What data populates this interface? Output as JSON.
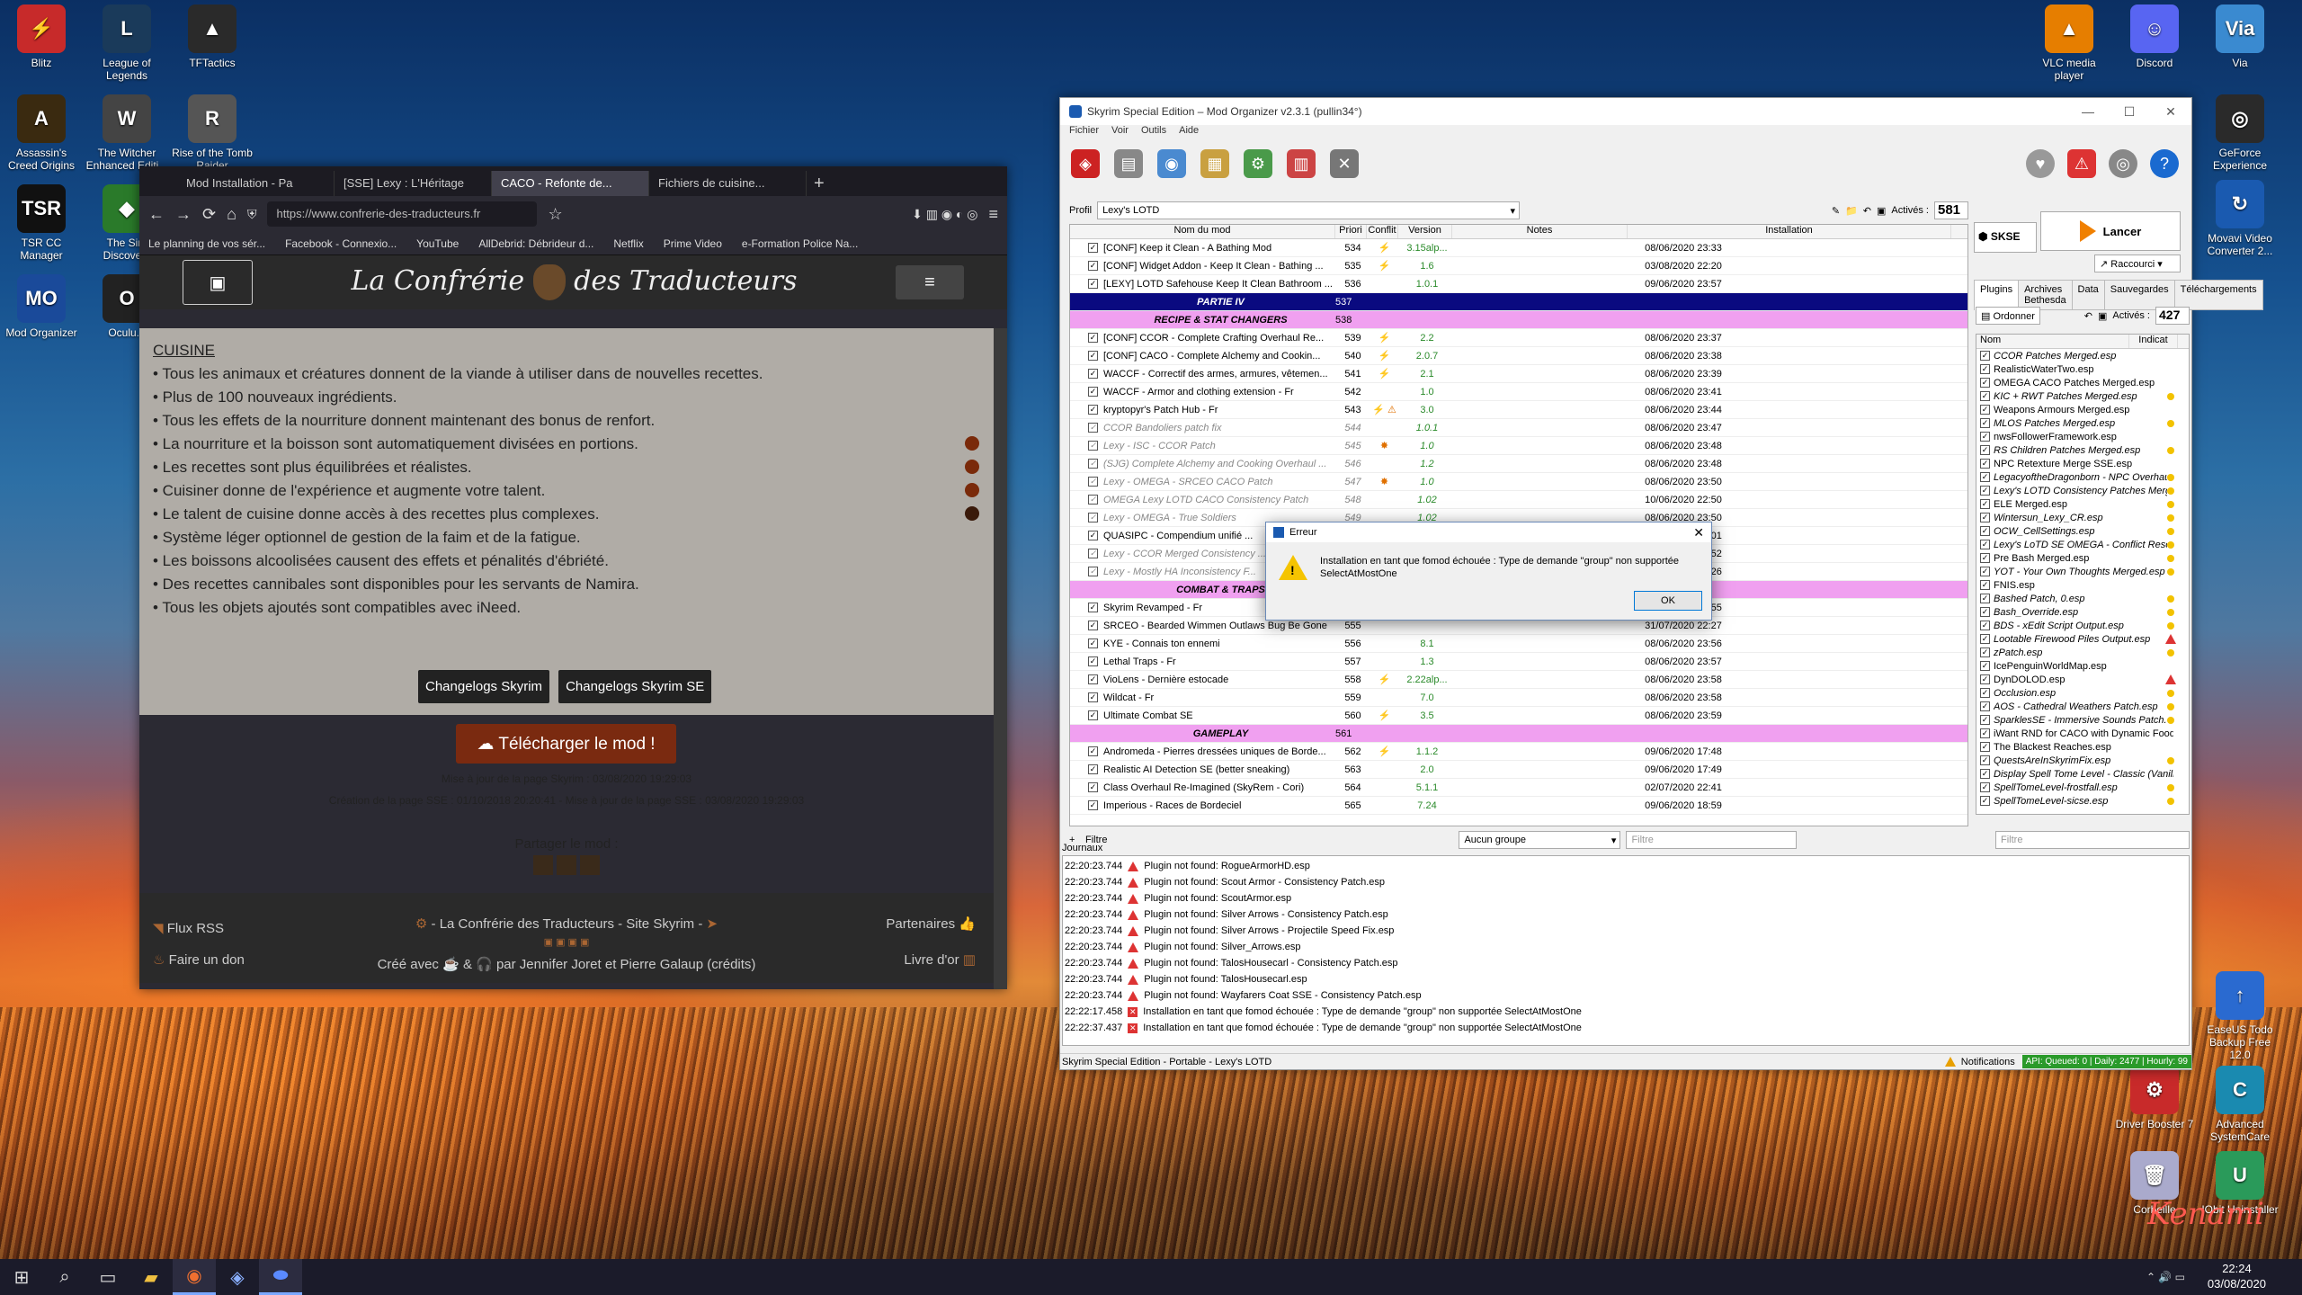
{
  "desktop": {
    "left_icons": [
      {
        "label": "Blitz",
        "color": "#c72a2a",
        "glyph": "⚡"
      },
      {
        "label": "League of Legends",
        "color": "#1a3a5a",
        "glyph": "L"
      },
      {
        "label": "TFTactics",
        "color": "#2a2a2a",
        "glyph": "▲"
      },
      {
        "label": "Assassin's Creed Origins",
        "color": "#3a2a10",
        "glyph": "A"
      },
      {
        "label": "The Witcher Enhanced Editi...",
        "color": "#444",
        "glyph": "W"
      },
      {
        "label": "Rise of the Tomb Raider",
        "color": "#555",
        "glyph": "R"
      },
      {
        "label": "TSR CC Manager",
        "color": "#111",
        "glyph": "TSR"
      },
      {
        "label": "The Sim Discove...",
        "color": "#2a7a2a",
        "glyph": "◆"
      },
      {
        "label": "Mod Organizer",
        "color": "#1a4a9a",
        "glyph": "MO"
      },
      {
        "label": "Oculu...",
        "color": "#222",
        "glyph": "O"
      }
    ],
    "right_icons": [
      {
        "label": "VLC media player",
        "color": "#e67e00",
        "glyph": "▲"
      },
      {
        "label": "Discord",
        "color": "#5865f2",
        "glyph": "☺"
      },
      {
        "label": "Via",
        "color": "#3a8ad0",
        "glyph": "Via"
      },
      {
        "label": "GeForce Experience",
        "color": "#2a2a2a",
        "glyph": "◎"
      },
      {
        "label": "Movavi Video Converter 2...",
        "color": "#1a5ab0",
        "glyph": "↻"
      },
      {
        "label": "EaseUS Todo Backup Free 12.0",
        "color": "#2a6ad0",
        "glyph": "↑"
      },
      {
        "label": "Driver Booster 7",
        "color": "#c82a2a",
        "glyph": "⚙"
      },
      {
        "label": "Advanced SystemCare",
        "color": "#1a8ab0",
        "glyph": "C"
      },
      {
        "label": "Corbeille",
        "color": "#aac",
        "glyph": "🗑"
      },
      {
        "label": "IObit Uninstaller",
        "color": "#2a9a5a",
        "glyph": "U"
      }
    ],
    "watermark": "Kenami"
  },
  "browser": {
    "tabs": [
      "Mod Installation - Pa",
      "[SSE] Lexy : L'Héritage",
      "CACO - Refonte de...",
      "Fichiers de cuisine..."
    ],
    "url": "https://www.confrerie-des-traducteurs.fr",
    "bookmarks": [
      "Le planning de vos sér...",
      "Facebook - Connexio...",
      "YouTube",
      "AllDebrid: Débrideur d...",
      "Netflix",
      "Prime Video",
      "e-Formation Police Na..."
    ],
    "site_title_left": "La Confrérie",
    "site_title_right": "des Traducteurs",
    "section": "CUISINE",
    "bullets": [
      "• Tous les animaux et créatures donnent de la viande à utiliser dans de nouvelles recettes.",
      "• Plus de 100 nouveaux ingrédients.",
      "• Tous les effets de la nourriture donnent maintenant des bonus de renfort.",
      "• La nourriture et la boisson sont automatiquement divisées en portions.",
      "• Les recettes sont plus équilibrées et réalistes.",
      "• Cuisiner donne de l'expérience et augmente votre talent.",
      "• Le talent de cuisine donne accès à des recettes plus complexes.",
      "• Système léger optionnel de gestion de la faim et de la fatigue.",
      "• Les boissons alcoolisées causent des effets et pénalités d'ébriété.",
      "• Des recettes cannibales sont disponibles pour les servants de Namira.",
      "• Tous les objets ajoutés sont compatibles avec iNeed."
    ],
    "btn_changelog_skyrim": "Changelogs Skyrim",
    "btn_changelog_se": "Changelogs Skyrim SE",
    "btn_download": "☁ Télécharger le mod !",
    "update_line": "Mise à jour de la page Skyrim : 03/08/2020 19:29:03",
    "creation_line": "Création de la page SSE : 01/10/2018 20:20:41 - Mise à jour de la page SSE : 03/08/2020 19:29:03",
    "share_label": "Partager le mod :",
    "footer": {
      "rss": "Flux RSS",
      "don": "Faire un don",
      "center": "- La Confrérie des Traducteurs - Site Skyrim -",
      "partners": "Partenaires",
      "guestbook": "Livre d'or",
      "credits": "Créé avec ☕ & 🎧 par Jennifer Joret et Pierre Galaup (crédits)"
    }
  },
  "mo": {
    "title": "Skyrim Special Edition – Mod Organizer v2.3.1 (pullin34°)",
    "menu": [
      "Fichier",
      "Voir",
      "Outils",
      "Aide"
    ],
    "profile_label": "Profil",
    "profile": "Lexy's LOTD",
    "active_label": "Activés :",
    "active_count": "581",
    "headers": [
      "Nom du mod",
      "Priori",
      "Conflit",
      "Version",
      "Notes",
      "Installation"
    ],
    "rows": [
      {
        "t": "m",
        "name": "[CONF] Keep it Clean - A Bathing Mod",
        "prio": "534",
        "conf": "⚡",
        "ver": "3.15alp...",
        "inst": "08/06/2020 23:33",
        "on": true
      },
      {
        "t": "m",
        "name": "[CONF] Widget Addon - Keep It Clean - Bathing ...",
        "prio": "535",
        "conf": "⚡",
        "ver": "1.6",
        "inst": "03/08/2020 22:20",
        "on": true
      },
      {
        "t": "m",
        "name": "[LEXY] LOTD Safehouse Keep It Clean Bathroom ...",
        "prio": "536",
        "conf": "",
        "ver": "1.0.1",
        "inst": "09/06/2020 23:57",
        "on": true
      },
      {
        "t": "s",
        "name": "PARTIE IV",
        "prio": "537",
        "bg": "#0a0a80",
        "fg": "#fff"
      },
      {
        "t": "s",
        "name": "RECIPE & STAT CHANGERS",
        "prio": "538",
        "bg": "#f0a0f0",
        "fg": "#000"
      },
      {
        "t": "m",
        "name": "[CONF] CCOR - Complete Crafting Overhaul Re...",
        "prio": "539",
        "conf": "⚡",
        "ver": "2.2",
        "inst": "08/06/2020 23:37",
        "on": true
      },
      {
        "t": "m",
        "name": "[CONF] CACO - Complete Alchemy and Cookin...",
        "prio": "540",
        "conf": "⚡",
        "ver": "2.0.7",
        "inst": "08/06/2020 23:38",
        "on": true
      },
      {
        "t": "m",
        "name": "WACCF - Correctif des armes, armures, vêtemen...",
        "prio": "541",
        "conf": "⚡",
        "ver": "2.1",
        "inst": "08/06/2020 23:39",
        "on": true
      },
      {
        "t": "m",
        "name": "WACCF - Armor and clothing extension - Fr",
        "prio": "542",
        "conf": "",
        "ver": "1.0",
        "inst": "08/06/2020 23:41",
        "on": true
      },
      {
        "t": "m",
        "name": "kryptopyr's Patch Hub - Fr",
        "prio": "543",
        "conf": "⚡ ⚠",
        "ver": "3.0",
        "inst": "08/06/2020 23:44",
        "on": true
      },
      {
        "t": "m",
        "name": "CCOR Bandoliers patch fix",
        "prio": "544",
        "conf": "",
        "ver": "1.0.1",
        "inst": "08/06/2020 23:47",
        "on": true,
        "it": true
      },
      {
        "t": "m",
        "name": "Lexy - ISC - CCOR Patch",
        "prio": "545",
        "conf": "✸",
        "ver": "1.0",
        "inst": "08/06/2020 23:48",
        "on": true,
        "it": true
      },
      {
        "t": "m",
        "name": "(SJG) Complete Alchemy and Cooking Overhaul ...",
        "prio": "546",
        "conf": "",
        "ver": "1.2",
        "inst": "08/06/2020 23:48",
        "on": true,
        "it": true
      },
      {
        "t": "m",
        "name": "Lexy - OMEGA - SRCEO CACO Patch",
        "prio": "547",
        "conf": "✸",
        "ver": "1.0",
        "inst": "08/06/2020 23:50",
        "on": true,
        "it": true
      },
      {
        "t": "m",
        "name": "OMEGA Lexy LOTD CACO Consistency Patch",
        "prio": "548",
        "conf": "",
        "ver": "1.02",
        "inst": "10/06/2020 22:50",
        "on": true,
        "it": true
      },
      {
        "t": "m",
        "name": "Lexy - OMEGA - True Soldiers",
        "prio": "549",
        "conf": "",
        "ver": "1.02",
        "inst": "08/06/2020 23:50",
        "on": true,
        "it": true
      },
      {
        "t": "m",
        "name": "QUASIPC - Compendium unifié ...",
        "prio": "550",
        "conf": "",
        "ver": "",
        "inst": "03/08/2020 09:01",
        "on": true
      },
      {
        "t": "m",
        "name": "Lexy - CCOR Merged Consistency ...",
        "prio": "551",
        "conf": "",
        "ver": "",
        "inst": "08/06/2020 23:52",
        "on": true,
        "it": true
      },
      {
        "t": "m",
        "name": "Lexy - Mostly HA Inconsistency F...",
        "prio": "552",
        "conf": "",
        "ver": "",
        "inst": "07/07/2020 22:26",
        "on": true,
        "it": true
      },
      {
        "t": "s",
        "name": "COMBAT & TRAPS",
        "prio": "553",
        "bg": "#f0a0f0",
        "fg": "#000"
      },
      {
        "t": "m",
        "name": "Skyrim Revamped - Fr",
        "prio": "554",
        "conf": "",
        "ver": "",
        "inst": "08/06/2020 23:55",
        "on": true
      },
      {
        "t": "m",
        "name": "SRCEO - Bearded Wimmen Outlaws Bug Be Gone",
        "prio": "555",
        "conf": "",
        "ver": "",
        "inst": "31/07/2020 22:27",
        "on": true
      },
      {
        "t": "m",
        "name": "KYE - Connais ton ennemi",
        "prio": "556",
        "conf": "",
        "ver": "8.1",
        "inst": "08/06/2020 23:56",
        "on": true
      },
      {
        "t": "m",
        "name": "Lethal Traps - Fr",
        "prio": "557",
        "conf": "",
        "ver": "1.3",
        "inst": "08/06/2020 23:57",
        "on": true
      },
      {
        "t": "m",
        "name": "VioLens - Dernière estocade",
        "prio": "558",
        "conf": "⚡",
        "ver": "2.22alp...",
        "inst": "08/06/2020 23:58",
        "on": true
      },
      {
        "t": "m",
        "name": "Wildcat - Fr",
        "prio": "559",
        "conf": "",
        "ver": "7.0",
        "inst": "08/06/2020 23:58",
        "on": true
      },
      {
        "t": "m",
        "name": "Ultimate Combat SE",
        "prio": "560",
        "conf": "⚡",
        "ver": "3.5",
        "inst": "08/06/2020 23:59",
        "on": true
      },
      {
        "t": "s",
        "name": "GAMEPLAY",
        "prio": "561",
        "bg": "#f0a0f0",
        "fg": "#000"
      },
      {
        "t": "m",
        "name": "Andromeda - Pierres dressées uniques de Borde...",
        "prio": "562",
        "conf": "⚡",
        "ver": "1.1.2",
        "inst": "09/06/2020 17:48",
        "on": true
      },
      {
        "t": "m",
        "name": "Realistic AI Detection SE (better sneaking)",
        "prio": "563",
        "conf": "",
        "ver": "2.0",
        "inst": "09/06/2020 17:49",
        "on": true
      },
      {
        "t": "m",
        "name": "Class Overhaul Re-Imagined (SkyRem - Cori)",
        "prio": "564",
        "conf": "",
        "ver": "5.1.1",
        "inst": "02/07/2020 22:41",
        "on": true
      },
      {
        "t": "m",
        "name": "Imperious - Races de Bordeciel",
        "prio": "565",
        "conf": "",
        "ver": "7.24",
        "inst": "09/06/2020 18:59",
        "on": true
      }
    ],
    "filter_label": "Filtre",
    "group_combo": "Aucun groupe",
    "filter_placeholder": "Filtre",
    "launcher": "SKSE",
    "launch_btn": "Lancer",
    "shortcut": "Raccourci",
    "right_tabs": [
      "Plugins",
      "Archives Bethesda",
      "Data",
      "Sauvegardes",
      "Téléchargements"
    ],
    "sort_btn": "Ordonner",
    "plugins_active_label": "Activés :",
    "plugins_active": "427",
    "plugin_headers": [
      "Nom",
      "Indicat"
    ],
    "plugins": [
      {
        "n": "CCOR Patches Merged.esp",
        "it": true,
        "ind": ""
      },
      {
        "n": "RealisticWaterTwo.esp",
        "it": false,
        "ind": ""
      },
      {
        "n": "OMEGA CACO Patches Merged.esp",
        "it": false,
        "ind": ""
      },
      {
        "n": "KIC + RWT Patches Merged.esp",
        "it": true,
        "ind": "y"
      },
      {
        "n": "Weapons Armours Merged.esp",
        "it": false,
        "ind": ""
      },
      {
        "n": "MLOS Patches Merged.esp",
        "it": true,
        "ind": "y"
      },
      {
        "n": "nwsFollowerFramework.esp",
        "it": false,
        "ind": ""
      },
      {
        "n": "RS Children Patches Merged.esp",
        "it": true,
        "ind": "y"
      },
      {
        "n": "NPC Retexture Merge SSE.esp",
        "it": false,
        "ind": ""
      },
      {
        "n": "LegacyoftheDragonborn - NPC Overhaul.esp",
        "it": true,
        "ind": "y"
      },
      {
        "n": "Lexy's LOTD Consistency Patches Merged.esp",
        "it": true,
        "ind": "y"
      },
      {
        "n": "ELE Merged.esp",
        "it": false,
        "ind": "y"
      },
      {
        "n": "Wintersun_Lexy_CR.esp",
        "it": true,
        "ind": "y"
      },
      {
        "n": "OCW_CellSettings.esp",
        "it": true,
        "ind": "y"
      },
      {
        "n": "Lexy's LoTD SE OMEGA - Conflict Resolution.esp",
        "it": true,
        "ind": "y"
      },
      {
        "n": "Pre Bash Merged.esp",
        "it": false,
        "ind": "y"
      },
      {
        "n": "YOT - Your Own Thoughts Merged.esp",
        "it": true,
        "ind": "y"
      },
      {
        "n": "FNIS.esp",
        "it": false,
        "ind": ""
      },
      {
        "n": "Bashed Patch, 0.esp",
        "it": true,
        "ind": "y"
      },
      {
        "n": "Bash_Override.esp",
        "it": true,
        "ind": "y"
      },
      {
        "n": "BDS - xEdit Script Output.esp",
        "it": true,
        "ind": "y"
      },
      {
        "n": "Lootable Firewood Piles Output.esp",
        "it": true,
        "ind": "w"
      },
      {
        "n": "zPatch.esp",
        "it": true,
        "ind": "y"
      },
      {
        "n": "IcePenguinWorldMap.esp",
        "it": false,
        "ind": ""
      },
      {
        "n": "DynDOLOD.esp",
        "it": false,
        "ind": "w"
      },
      {
        "n": "Occlusion.esp",
        "it": true,
        "ind": "y"
      },
      {
        "n": "AOS - Cathedral Weathers Patch.esp",
        "it": true,
        "ind": "y"
      },
      {
        "n": "SparklesSE - Immersive Sounds Patch.esp",
        "it": true,
        "ind": "y"
      },
      {
        "n": "iWant RND for CACO with Dynamic Food.esp",
        "it": false,
        "ind": ""
      },
      {
        "n": "The Blackest Reaches.esp",
        "it": false,
        "ind": ""
      },
      {
        "n": "QuestsAreInSkyrimFix.esp",
        "it": true,
        "ind": "y"
      },
      {
        "n": "Display Spell Tome Level - Classic (Vanilla).esl",
        "it": true,
        "ind": ""
      },
      {
        "n": "SpellTomeLevel-frostfall.esp",
        "it": true,
        "ind": "y"
      },
      {
        "n": "SpellTomeLevel-sicse.esp",
        "it": true,
        "ind": "y"
      }
    ],
    "journal_label": "Journaux",
    "log": [
      {
        "k": "w",
        "time": "22:20:23.744",
        "msg": "Plugin not found: RogueArmorHD.esp"
      },
      {
        "k": "w",
        "time": "22:20:23.744",
        "msg": "Plugin not found: Scout Armor - Consistency Patch.esp"
      },
      {
        "k": "w",
        "time": "22:20:23.744",
        "msg": "Plugin not found: ScoutArmor.esp"
      },
      {
        "k": "w",
        "time": "22:20:23.744",
        "msg": "Plugin not found: Silver Arrows - Consistency Patch.esp"
      },
      {
        "k": "w",
        "time": "22:20:23.744",
        "msg": "Plugin not found: Silver Arrows - Projectile Speed Fix.esp"
      },
      {
        "k": "w",
        "time": "22:20:23.744",
        "msg": "Plugin not found: Silver_Arrows.esp"
      },
      {
        "k": "w",
        "time": "22:20:23.744",
        "msg": "Plugin not found: TalosHousecarl - Consistency Patch.esp"
      },
      {
        "k": "w",
        "time": "22:20:23.744",
        "msg": "Plugin not found: TalosHousecarl.esp"
      },
      {
        "k": "w",
        "time": "22:20:23.744",
        "msg": "Plugin not found: Wayfarers Coat SSE - Consistency Patch.esp"
      },
      {
        "k": "e",
        "time": "22:22:17.458",
        "msg": "Installation en tant que fomod échouée : Type de demande \"group\" non supportée SelectAtMostOne"
      },
      {
        "k": "e",
        "time": "22:22:37.437",
        "msg": "Installation en tant que fomod échouée : Type de demande \"group\" non supportée SelectAtMostOne"
      }
    ],
    "status_left": "Skyrim Special Edition - Portable - Lexy's LOTD",
    "notifications": "Notifications",
    "api": "API: Queued: 0 | Daily: 2477 | Hourly: 99"
  },
  "dialog": {
    "title": "Erreur",
    "message": "Installation en tant que fomod échouée : Type de demande \"group\" non supportée SelectAtMostOne",
    "ok": "OK"
  },
  "taskbar": {
    "time": "22:24",
    "date": "03/08/2020"
  }
}
